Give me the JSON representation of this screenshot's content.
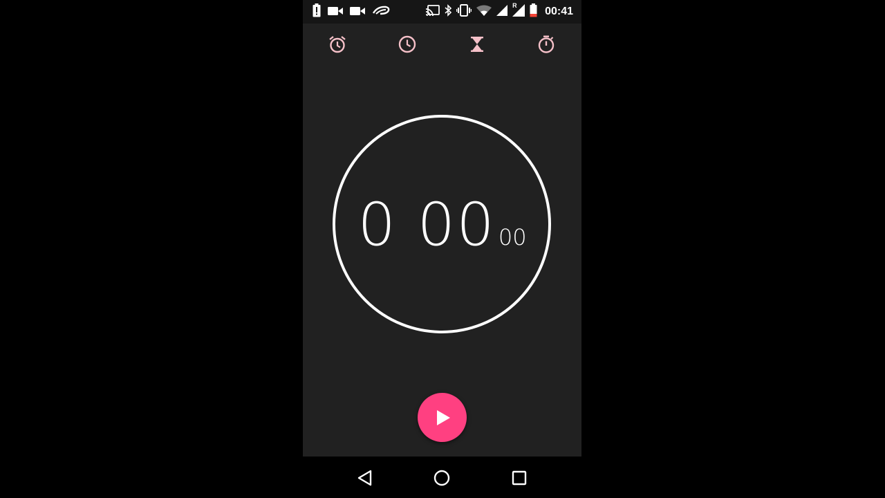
{
  "status_bar": {
    "time": "00:41",
    "left_icons": [
      "battery-alert-icon",
      "video-camera-icon",
      "video-camera-icon",
      "app-notification-icon"
    ],
    "right_icons": [
      "cast-icon",
      "bluetooth-icon",
      "vibrate-icon",
      "wifi-icon",
      "signal-icon",
      "signal-roaming-icon",
      "battery-low-icon"
    ],
    "roaming_label": "R"
  },
  "tabs": [
    {
      "name": "alarm",
      "icon": "alarm-clock-icon"
    },
    {
      "name": "clock",
      "icon": "clock-icon"
    },
    {
      "name": "timer",
      "icon": "hourglass-icon"
    },
    {
      "name": "stopwatch",
      "icon": "stopwatch-icon"
    }
  ],
  "stopwatch": {
    "main": "0 00",
    "centiseconds": "00"
  },
  "fab": {
    "icon": "play-icon"
  },
  "nav": [
    {
      "name": "back",
      "icon": "back-triangle-icon"
    },
    {
      "name": "home",
      "icon": "home-circle-icon"
    },
    {
      "name": "recents",
      "icon": "recents-square-icon"
    }
  ],
  "colors": {
    "accent": "#ff4081",
    "background": "#212121",
    "status_bar": "#161616",
    "tab_icon": "#f6c1c9",
    "dial": "#ffffff"
  }
}
